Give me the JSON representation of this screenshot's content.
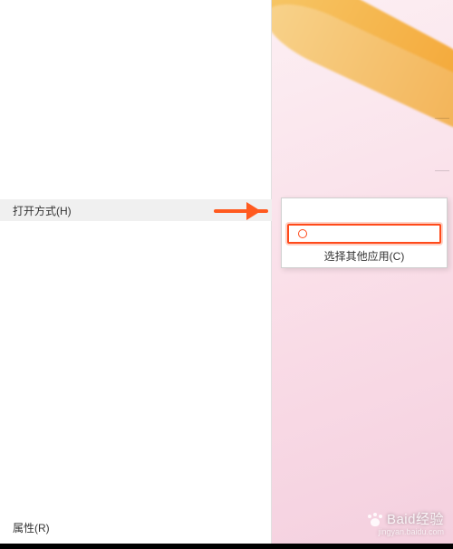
{
  "context_menu": {
    "open_with": {
      "label": "打开方式(H)"
    },
    "properties": {
      "label": "属性(R)"
    }
  },
  "submenu": {
    "choose_other": "选择其他应用(C)"
  },
  "watermark": {
    "brand": "Baid",
    "brand_cn": "经验",
    "sub": "jingyan.baidu.com"
  },
  "annotation": {
    "arrow_color": "#ff5a1f",
    "highlight_color": "#ff4a1a"
  }
}
